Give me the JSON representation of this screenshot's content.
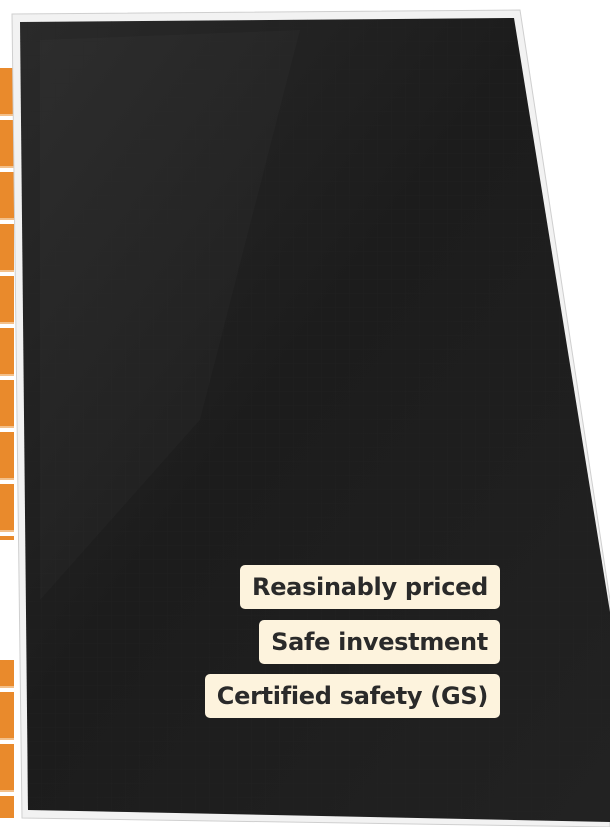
{
  "image": {
    "subject": "solar-panel-product-photo",
    "panel_color": "#1e1e1e",
    "frame_color": "#f2f2f2",
    "accent_color": "#e98a2c",
    "label_background": "#fdf3dd"
  },
  "features": [
    {
      "label": "Reasinably priced"
    },
    {
      "label": "Safe investment"
    },
    {
      "label": "Certified safety (GS)"
    }
  ]
}
